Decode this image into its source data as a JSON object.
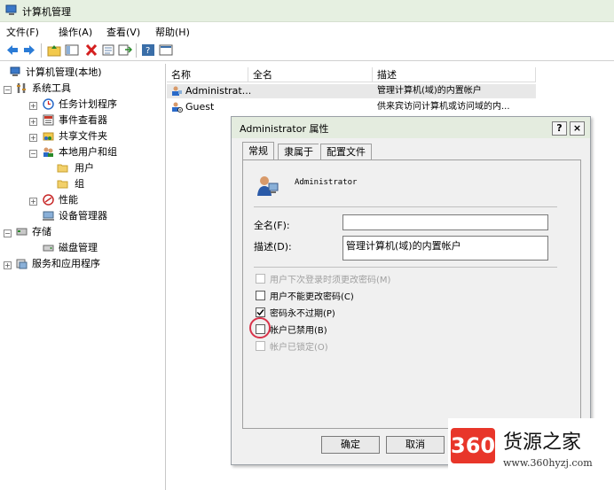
{
  "window": {
    "title": "计算机管理"
  },
  "menu": [
    {
      "label": "文件(F)"
    },
    {
      "label": "操作(A)"
    },
    {
      "label": "查看(V)"
    },
    {
      "label": "帮助(H)"
    }
  ],
  "tree": {
    "items": [
      {
        "label": "计算机管理(本地)"
      },
      {
        "label": "系统工具"
      },
      {
        "label": "任务计划程序"
      },
      {
        "label": "事件查看器"
      },
      {
        "label": "共享文件夹"
      },
      {
        "label": "本地用户和组"
      },
      {
        "label": "用户"
      },
      {
        "label": "组"
      },
      {
        "label": "性能"
      },
      {
        "label": "设备管理器"
      },
      {
        "label": "存储"
      },
      {
        "label": "磁盘管理"
      },
      {
        "label": "服务和应用程序"
      }
    ]
  },
  "list": {
    "columns": [
      "名称",
      "全名",
      "描述"
    ],
    "rows": [
      {
        "name": "Administrat...",
        "fullname": "",
        "desc": "管理计算机(域)的内置帐户"
      },
      {
        "name": "Guest",
        "fullname": "",
        "desc": "供来宾访问计算机或访问域的内..."
      }
    ]
  },
  "dialog": {
    "title": "Administrator 属性",
    "help_label": "?",
    "close_label": "×",
    "tabs": [
      {
        "label": "常规"
      },
      {
        "label": "隶属于"
      },
      {
        "label": "配置文件"
      }
    ],
    "username": "Administrator",
    "fullname_label": "全名(F):",
    "fullname_value": "",
    "desc_label": "描述(D):",
    "desc_value": "管理计算机(域)的内置帐户",
    "checkboxes": [
      {
        "label": "用户下次登录时须更改密码(M)",
        "checked": false,
        "enabled": false
      },
      {
        "label": "用户不能更改密码(C)",
        "checked": false,
        "enabled": true
      },
      {
        "label": "密码永不过期(P)",
        "checked": true,
        "enabled": true
      },
      {
        "label": "帐户已禁用(B)",
        "checked": false,
        "enabled": true
      },
      {
        "label": "帐户已锁定(O)",
        "checked": false,
        "enabled": false
      }
    ],
    "ok_label": "确定",
    "cancel_label": "取消"
  },
  "watermark": {
    "logo": "360",
    "text": "货源之家",
    "url": "www.360hyzj.com"
  },
  "colors": {
    "titlebar": "#e6f0e1",
    "highlight": "#d8334a",
    "accent": "#e8362a"
  }
}
